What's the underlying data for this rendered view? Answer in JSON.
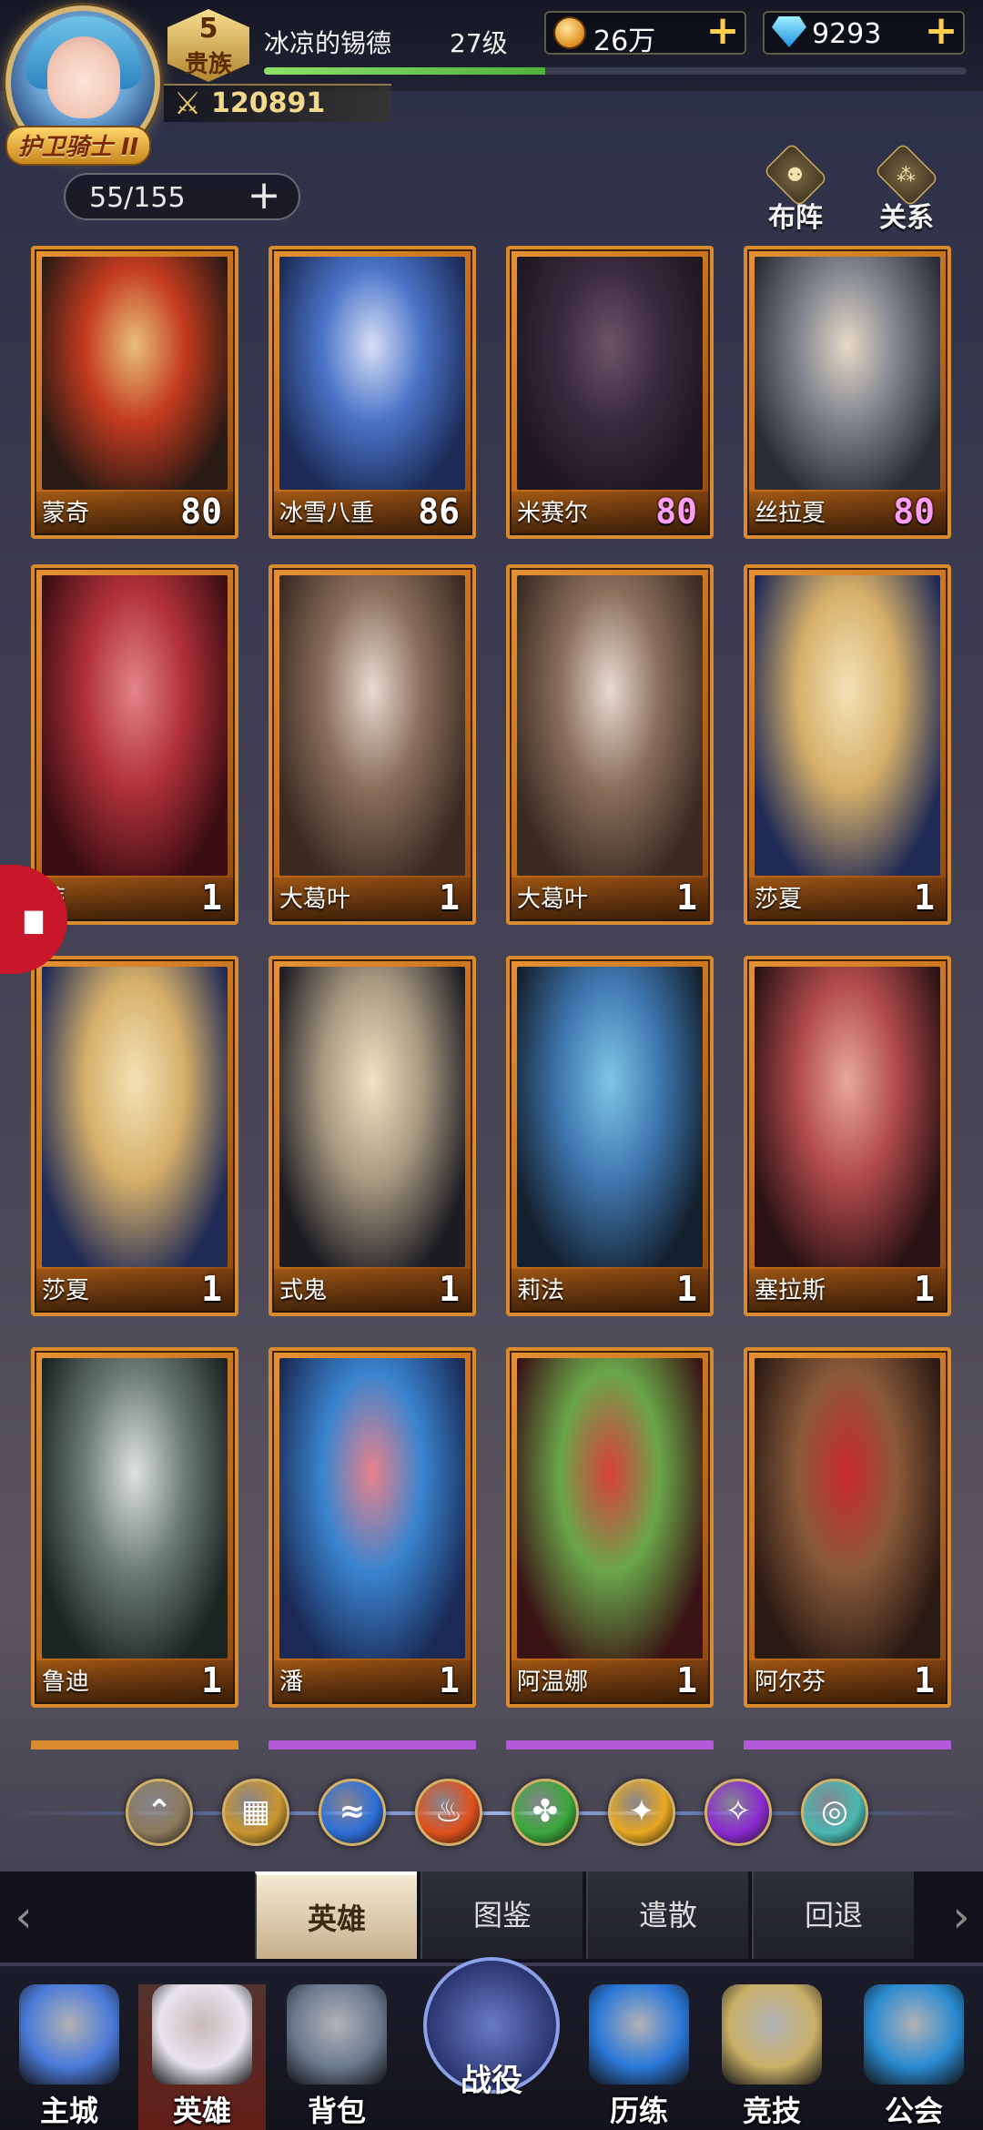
{
  "player": {
    "title": "护卫骑士 II",
    "vip_level": "5",
    "vip_label": "贵族",
    "name": "冰凉的锡德",
    "level": "27级",
    "power": "120891",
    "exp_fraction": 0.4
  },
  "resources": {
    "gold": "26万",
    "gems": "9293",
    "gold_icon": "coin-icon",
    "gem_icon": "diamond-icon"
  },
  "hero_count": "55/155",
  "side_buttons": {
    "formation": "布阵",
    "relations": "关系"
  },
  "heroes": [
    {
      "name": "蒙奇",
      "level": "80",
      "level_color": "white",
      "art": [
        "#2a1a14",
        "#c33b1f",
        "#e8c07a"
      ]
    },
    {
      "name": "冰雪八重",
      "level": "86",
      "level_color": "white",
      "art": [
        "#1c2a55",
        "#4a74c8",
        "#d7dff5"
      ]
    },
    {
      "name": "米赛尔",
      "level": "80",
      "level_color": "pink",
      "art": [
        "#1e1620",
        "#3a2b3e",
        "#6b5468"
      ]
    },
    {
      "name": "丝拉夏",
      "level": "80",
      "level_color": "pink",
      "art": [
        "#2a2c35",
        "#7f848f",
        "#e7d9c6"
      ]
    },
    {
      "name": "蒂",
      "level": "1",
      "level_color": "white",
      "art": [
        "#3a0e12",
        "#b1303a",
        "#e3848a"
      ]
    },
    {
      "name": "大葛叶",
      "level": "1",
      "level_color": "white",
      "art": [
        "#3a2a22",
        "#8a6e5c",
        "#e8dbd2"
      ]
    },
    {
      "name": "大葛叶",
      "level": "1",
      "level_color": "white",
      "art": [
        "#3a2a22",
        "#8a6e5c",
        "#e8dbd2"
      ]
    },
    {
      "name": "莎夏",
      "level": "1",
      "level_color": "white",
      "art": [
        "#1f2a55",
        "#d6b06a",
        "#f3e2b6"
      ]
    },
    {
      "name": "莎夏",
      "level": "1",
      "level_color": "white",
      "art": [
        "#1f2a55",
        "#d6b06a",
        "#f3e2b6"
      ]
    },
    {
      "name": "式鬼",
      "level": "1",
      "level_color": "white",
      "art": [
        "#1c1c22",
        "#a89a82",
        "#f0e2c2"
      ]
    },
    {
      "name": "莉法",
      "level": "1",
      "level_color": "white",
      "art": [
        "#14202e",
        "#3f78b0",
        "#7ec6e6"
      ]
    },
    {
      "name": "塞拉斯",
      "level": "1",
      "level_color": "white",
      "art": [
        "#2a1214",
        "#b04a4c",
        "#e8a89a"
      ]
    },
    {
      "name": "鲁迪",
      "level": "1",
      "level_color": "white",
      "art": [
        "#1a2422",
        "#6d7c78",
        "#dfe3e0"
      ]
    },
    {
      "name": "潘",
      "level": "1",
      "level_color": "white",
      "art": [
        "#1a2a55",
        "#3a84cf",
        "#e8828c"
      ]
    },
    {
      "name": "阿温娜",
      "level": "1",
      "level_color": "white",
      "art": [
        "#3a1414",
        "#6aa64a",
        "#d8403a"
      ]
    },
    {
      "name": "阿尔芬",
      "level": "1",
      "level_color": "white",
      "art": [
        "#2a1a14",
        "#8a5a3a",
        "#c8282e"
      ]
    }
  ],
  "peek_row_colors": [
    "#d88a2c",
    "#b45ad8",
    "#b45ad8",
    "#b45ad8"
  ],
  "filters": [
    {
      "icon": "chevrons-up-icon",
      "glyph": "⌃",
      "color": "#8a7a5c"
    },
    {
      "icon": "grid-all-icon",
      "glyph": "▦",
      "color": "#c8952e"
    },
    {
      "icon": "water-element-icon",
      "glyph": "≈",
      "color": "#2d6fd8"
    },
    {
      "icon": "fire-element-icon",
      "glyph": "♨",
      "color": "#e0511c"
    },
    {
      "icon": "wind-element-icon",
      "glyph": "✤",
      "color": "#3aa83a"
    },
    {
      "icon": "light-element-icon",
      "glyph": "✦",
      "color": "#e8a820"
    },
    {
      "icon": "dark-element-icon",
      "glyph": "✧",
      "color": "#8a2ad0"
    },
    {
      "icon": "chaos-element-icon",
      "glyph": "◎",
      "color": "#4ab7b0"
    }
  ],
  "tabs": [
    {
      "label": "英雄",
      "active": true
    },
    {
      "label": "图鉴",
      "active": false
    },
    {
      "label": "遣散",
      "active": false
    },
    {
      "label": "回退",
      "active": false
    }
  ],
  "nav": [
    {
      "label": "主城",
      "icon": "castle-icon",
      "color": "#4a7ad8"
    },
    {
      "label": "英雄",
      "icon": "hero-portrait-icon",
      "color": "#e8e4ef"
    },
    {
      "label": "背包",
      "icon": "backpack-icon",
      "color": "#6b7a8f"
    },
    {
      "label": "战役",
      "icon": "crossed-swords-icon",
      "color": "#5a6ac0"
    },
    {
      "label": "历练",
      "icon": "hexagram-icon",
      "color": "#2a78d8"
    },
    {
      "label": "竞技",
      "icon": "sword-shield-icon",
      "color": "#c8b068"
    },
    {
      "label": "公会",
      "icon": "guild-shield-icon",
      "color": "#2a8ad0"
    }
  ]
}
